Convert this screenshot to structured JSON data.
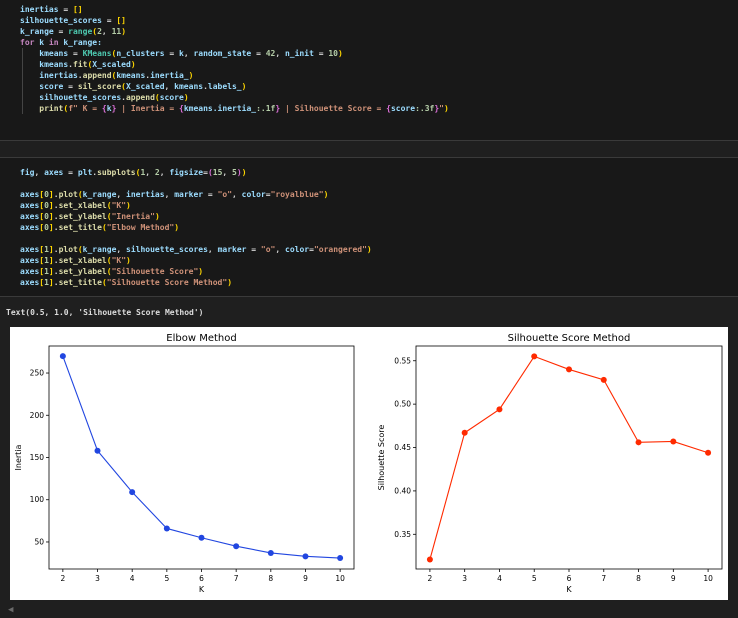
{
  "cells": [
    {
      "lines": [
        [
          [
            "inertias",
            "v"
          ],
          [
            " = ",
            "o"
          ],
          [
            "[]",
            "b"
          ]
        ],
        [
          [
            "silhouette_scores",
            "v"
          ],
          [
            " = ",
            "o"
          ],
          [
            "[]",
            "b"
          ]
        ],
        [
          [
            "k_range",
            "v"
          ],
          [
            " = ",
            "o"
          ],
          [
            "range",
            "c"
          ],
          [
            "(",
            "b"
          ],
          [
            "2",
            "n"
          ],
          [
            ", ",
            "o"
          ],
          [
            "11",
            "n"
          ],
          [
            ")",
            "b"
          ]
        ],
        [
          [
            "for",
            "k"
          ],
          [
            " k ",
            "v"
          ],
          [
            "in",
            "k"
          ],
          [
            " k_range:",
            "v"
          ]
        ],
        [
          [
            "    kmeans",
            "v"
          ],
          [
            " = ",
            "o"
          ],
          [
            "KMeans",
            "c"
          ],
          [
            "(",
            "b"
          ],
          [
            "n_clusters",
            "v"
          ],
          [
            " = ",
            "o"
          ],
          [
            "k",
            "v"
          ],
          [
            ", ",
            "o"
          ],
          [
            "random_state",
            "v"
          ],
          [
            " = ",
            "o"
          ],
          [
            "42",
            "n"
          ],
          [
            ", ",
            "o"
          ],
          [
            "n_init",
            "v"
          ],
          [
            " = ",
            "o"
          ],
          [
            "10",
            "n"
          ],
          [
            ")",
            "b"
          ]
        ],
        [
          [
            "    kmeans",
            "v"
          ],
          [
            ".",
            "o"
          ],
          [
            "fit",
            "f"
          ],
          [
            "(",
            "b"
          ],
          [
            "X_scaled",
            "v"
          ],
          [
            ")",
            "b"
          ]
        ],
        [
          [
            "    inertias",
            "v"
          ],
          [
            ".",
            "o"
          ],
          [
            "append",
            "f"
          ],
          [
            "(",
            "b"
          ],
          [
            "kmeans",
            "v"
          ],
          [
            ".",
            "o"
          ],
          [
            "inertia_",
            "v"
          ],
          [
            ")",
            "b"
          ]
        ],
        [
          [
            "    score",
            "v"
          ],
          [
            " = ",
            "o"
          ],
          [
            "sil_score",
            "f"
          ],
          [
            "(",
            "b"
          ],
          [
            "X_scaled",
            "v"
          ],
          [
            ", ",
            "o"
          ],
          [
            "kmeans",
            "v"
          ],
          [
            ".",
            "o"
          ],
          [
            "labels_",
            "v"
          ],
          [
            ")",
            "b"
          ]
        ],
        [
          [
            "    silhouette_scores",
            "v"
          ],
          [
            ".",
            "o"
          ],
          [
            "append",
            "f"
          ],
          [
            "(",
            "b"
          ],
          [
            "score",
            "v"
          ],
          [
            ")",
            "b"
          ]
        ],
        [
          [
            "    print",
            "f"
          ],
          [
            "(",
            "b"
          ],
          [
            "f\" K = ",
            "s"
          ],
          [
            "{",
            "p"
          ],
          [
            "k",
            "v"
          ],
          [
            "}",
            "p"
          ],
          [
            " | Inertia = ",
            "s"
          ],
          [
            "{",
            "p"
          ],
          [
            "kmeans.inertia_",
            "v"
          ],
          [
            ":.1f",
            "n"
          ],
          [
            "}",
            "p"
          ],
          [
            " | Silhouette Score = ",
            "s"
          ],
          [
            "{",
            "p"
          ],
          [
            "score",
            "v"
          ],
          [
            ":.3f",
            "n"
          ],
          [
            "}",
            "p"
          ],
          [
            "\"",
            "s"
          ],
          [
            ")",
            "b"
          ]
        ]
      ]
    },
    {
      "lines": [
        [
          [
            "fig",
            "v"
          ],
          [
            ", ",
            "o"
          ],
          [
            "axes",
            "v"
          ],
          [
            " = ",
            "o"
          ],
          [
            "plt",
            "v"
          ],
          [
            ".",
            "o"
          ],
          [
            "subplots",
            "f"
          ],
          [
            "(",
            "b"
          ],
          [
            "1",
            "n"
          ],
          [
            ", ",
            "o"
          ],
          [
            "2",
            "n"
          ],
          [
            ", ",
            "o"
          ],
          [
            "figsize",
            "v"
          ],
          [
            "=",
            "o"
          ],
          [
            "(",
            "p"
          ],
          [
            "15",
            "n"
          ],
          [
            ", ",
            "o"
          ],
          [
            "5",
            "n"
          ],
          [
            ")",
            "p"
          ],
          [
            ")",
            "b"
          ]
        ],
        [
          [
            "",
            "o"
          ]
        ],
        [
          [
            "axes",
            "v"
          ],
          [
            "[",
            "b"
          ],
          [
            "0",
            "n"
          ],
          [
            "]",
            "b"
          ],
          [
            ".",
            "o"
          ],
          [
            "plot",
            "f"
          ],
          [
            "(",
            "b"
          ],
          [
            "k_range",
            "v"
          ],
          [
            ", ",
            "o"
          ],
          [
            "inertias",
            "v"
          ],
          [
            ", ",
            "o"
          ],
          [
            "marker",
            "v"
          ],
          [
            " = ",
            "o"
          ],
          [
            "\"o\"",
            "s"
          ],
          [
            ", ",
            "o"
          ],
          [
            "color",
            "v"
          ],
          [
            "=",
            "o"
          ],
          [
            "\"royalblue\"",
            "s"
          ],
          [
            ")",
            "b"
          ]
        ],
        [
          [
            "axes",
            "v"
          ],
          [
            "[",
            "b"
          ],
          [
            "0",
            "n"
          ],
          [
            "]",
            "b"
          ],
          [
            ".",
            "o"
          ],
          [
            "set_xlabel",
            "f"
          ],
          [
            "(",
            "b"
          ],
          [
            "\"K\"",
            "s"
          ],
          [
            ")",
            "b"
          ]
        ],
        [
          [
            "axes",
            "v"
          ],
          [
            "[",
            "b"
          ],
          [
            "0",
            "n"
          ],
          [
            "]",
            "b"
          ],
          [
            ".",
            "o"
          ],
          [
            "set_ylabel",
            "f"
          ],
          [
            "(",
            "b"
          ],
          [
            "\"Inertia\"",
            "s"
          ],
          [
            ")",
            "b"
          ]
        ],
        [
          [
            "axes",
            "v"
          ],
          [
            "[",
            "b"
          ],
          [
            "0",
            "n"
          ],
          [
            "]",
            "b"
          ],
          [
            ".",
            "o"
          ],
          [
            "set_title",
            "f"
          ],
          [
            "(",
            "b"
          ],
          [
            "\"Elbow Method\"",
            "s"
          ],
          [
            ")",
            "b"
          ]
        ],
        [
          [
            "",
            "o"
          ]
        ],
        [
          [
            "axes",
            "v"
          ],
          [
            "[",
            "b"
          ],
          [
            "1",
            "n"
          ],
          [
            "]",
            "b"
          ],
          [
            ".",
            "o"
          ],
          [
            "plot",
            "f"
          ],
          [
            "(",
            "b"
          ],
          [
            "k_range",
            "v"
          ],
          [
            ", ",
            "o"
          ],
          [
            "silhouette_scores",
            "v"
          ],
          [
            ", ",
            "o"
          ],
          [
            "marker",
            "v"
          ],
          [
            " = ",
            "o"
          ],
          [
            "\"o\"",
            "s"
          ],
          [
            ", ",
            "o"
          ],
          [
            "color",
            "v"
          ],
          [
            "=",
            "o"
          ],
          [
            "\"orangered\"",
            "s"
          ],
          [
            ")",
            "b"
          ]
        ],
        [
          [
            "axes",
            "v"
          ],
          [
            "[",
            "b"
          ],
          [
            "1",
            "n"
          ],
          [
            "]",
            "b"
          ],
          [
            ".",
            "o"
          ],
          [
            "set_xlabel",
            "f"
          ],
          [
            "(",
            "b"
          ],
          [
            "\"K\"",
            "s"
          ],
          [
            ")",
            "b"
          ]
        ],
        [
          [
            "axes",
            "v"
          ],
          [
            "[",
            "b"
          ],
          [
            "1",
            "n"
          ],
          [
            "]",
            "b"
          ],
          [
            ".",
            "o"
          ],
          [
            "set_ylabel",
            "f"
          ],
          [
            "(",
            "b"
          ],
          [
            "\"Silhouette Score\"",
            "s"
          ],
          [
            ")",
            "b"
          ]
        ],
        [
          [
            "axes",
            "v"
          ],
          [
            "[",
            "b"
          ],
          [
            "1",
            "n"
          ],
          [
            "]",
            "b"
          ],
          [
            ".",
            "o"
          ],
          [
            "set_title",
            "f"
          ],
          [
            "(",
            "b"
          ],
          [
            "\"Silhouette Score Method\"",
            "s"
          ],
          [
            ")",
            "b"
          ]
        ]
      ]
    }
  ],
  "output_text": "Text(0.5, 1.0, 'Silhouette Score Method')",
  "scrollbar": {
    "left_arrow": "◀"
  },
  "chart_data": [
    {
      "type": "line",
      "title": "Elbow Method",
      "xlabel": "K",
      "ylabel": "Inertia",
      "x": [
        2,
        3,
        4,
        5,
        6,
        7,
        8,
        9,
        10
      ],
      "values": [
        270,
        158,
        109,
        66,
        55,
        45,
        37,
        33,
        31
      ],
      "xticks": [
        2,
        3,
        4,
        5,
        6,
        7,
        8,
        9,
        10
      ],
      "yticks": [
        50,
        100,
        150,
        200,
        250
      ],
      "xlim": [
        1.6,
        10.4
      ],
      "ylim": [
        18,
        282
      ],
      "color": "#2146e0",
      "grid": false
    },
    {
      "type": "line",
      "title": "Silhouette Score Method",
      "xlabel": "K",
      "ylabel": "Silhouette Score",
      "x": [
        2,
        3,
        4,
        5,
        6,
        7,
        8,
        9,
        10
      ],
      "values": [
        0.321,
        0.467,
        0.494,
        0.555,
        0.54,
        0.528,
        0.456,
        0.457,
        0.444
      ],
      "xticks": [
        2,
        3,
        4,
        5,
        6,
        7,
        8,
        9,
        10
      ],
      "yticks": [
        0.35,
        0.4,
        0.45,
        0.5,
        0.55
      ],
      "ytick_labels": [
        "0.35",
        "0.40",
        "0.45",
        "0.50",
        "0.55"
      ],
      "xlim": [
        1.6,
        10.4
      ],
      "ylim": [
        0.31,
        0.567
      ],
      "color": "#ff2a00",
      "grid": false
    }
  ]
}
